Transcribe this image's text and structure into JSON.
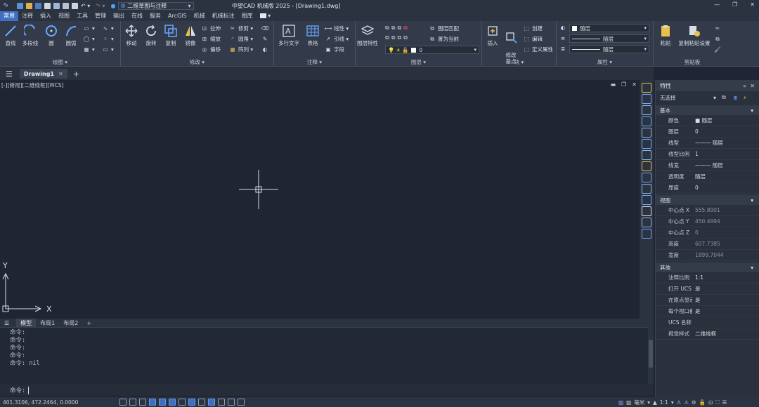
{
  "app": {
    "title": "中望CAD 机械版 2025 - [Drawing1.dwg]",
    "workspace": "二维草图与注释"
  },
  "menu": [
    "常用",
    "注释",
    "插入",
    "视图",
    "工具",
    "管理",
    "输出",
    "在线",
    "服务",
    "ArcGIS",
    "机械",
    "机械标注",
    "图库"
  ],
  "ribbon": {
    "draw": {
      "label": "绘图 ▾",
      "line": "直线",
      "polyline": "多段线",
      "circle": "圆",
      "arc": "圆弧"
    },
    "modify": {
      "label": "修改 ▾",
      "move": "移动",
      "rotate": "旋转",
      "copy": "复制",
      "mirror": "镜像",
      "stretch": "拉伸",
      "scale": "缩放",
      "offset": "偏移",
      "trim": "修剪",
      "fillet": "圆角",
      "array": "阵列"
    },
    "annotate": {
      "label": "注释 ▾",
      "mtext": "多行文字",
      "table": "表格",
      "linear": "线性",
      "leader": "引线",
      "field": "字段"
    },
    "layer": {
      "label": "图层 ▾",
      "properties": "图层特性",
      "match": "图层匹配",
      "set_current": "置为当前",
      "current_layer": "0"
    },
    "block": {
      "label": "块 ▾",
      "insert": "插入",
      "edit_base": "修改\n基点",
      "create": "创建",
      "edit": "编辑",
      "attdef": "定义属性"
    },
    "properties": {
      "label": "属性 ▾",
      "color": "随层",
      "linetype": "随层",
      "lineweight": "随层"
    },
    "clipboard": {
      "label": "剪贴板",
      "paste": "粘贴",
      "copy_settings": "复制粘贴设置"
    }
  },
  "tabs": {
    "document": "Drawing1",
    "add": "+"
  },
  "viewport": {
    "label": "[-][俯视][二维线框][WCS]",
    "axis_x": "X",
    "axis_y": "Y"
  },
  "layout_tabs": [
    "模型",
    "布局1",
    "布局2",
    "+"
  ],
  "command": {
    "history": [
      "命令:",
      "命令:",
      "命令:",
      "命令:",
      "命令: nil"
    ],
    "prompt": "命令:"
  },
  "status": {
    "coords": "401.3106, 472.2464, 0.0000",
    "units": "毫米",
    "scale": "1:1"
  },
  "panel": {
    "title": "特性",
    "selection": "无选择",
    "sections": [
      {
        "name": "基本",
        "rows": [
          {
            "k": "颜色",
            "v": "■ 随层"
          },
          {
            "k": "图层",
            "v": "0"
          },
          {
            "k": "线型",
            "v": "——— 随层"
          },
          {
            "k": "线型比例",
            "v": "1"
          },
          {
            "k": "线宽",
            "v": "——— 随层"
          },
          {
            "k": "透明度",
            "v": "随层"
          },
          {
            "k": "厚度",
            "v": "0"
          }
        ]
      },
      {
        "name": "视图",
        "rows": [
          {
            "k": "中心点 X",
            "v": "555.8901"
          },
          {
            "k": "中心点 Y",
            "v": "450.4994"
          },
          {
            "k": "中心点 Z",
            "v": "0"
          },
          {
            "k": "高度",
            "v": "607.7385"
          },
          {
            "k": "宽度",
            "v": "1899.7044"
          }
        ]
      },
      {
        "name": "其他",
        "rows": [
          {
            "k": "注释比例",
            "v": "1:1"
          },
          {
            "k": "打开 UCS ...",
            "v": "是"
          },
          {
            "k": "在原点显示 ...",
            "v": "是"
          },
          {
            "k": "每个视口都...",
            "v": "是"
          },
          {
            "k": "UCS 名称",
            "v": ""
          },
          {
            "k": "视觉样式",
            "v": "二维线框"
          }
        ]
      }
    ]
  }
}
